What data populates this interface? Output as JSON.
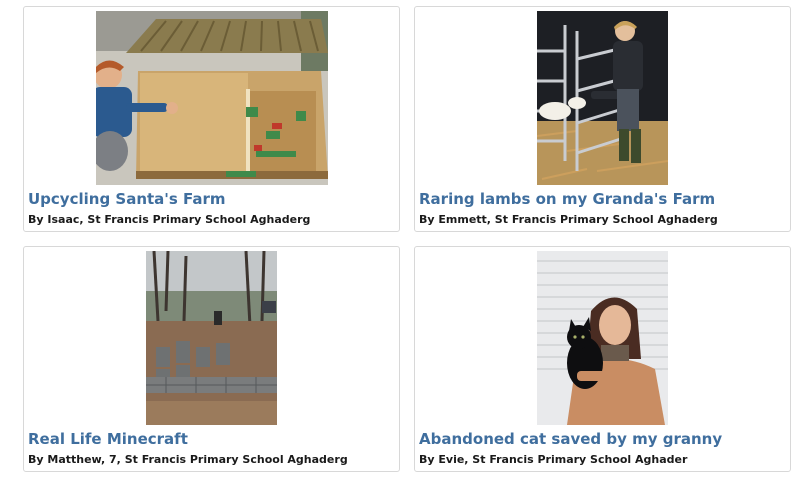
{
  "accent_link_color": "#3f6e9e",
  "cards": [
    {
      "title": "Upcycling Santa's Farm",
      "byline": "By Isaac, St Francis Primary School Aghaderg",
      "image_subject": "boy beside handmade wooden toy farm"
    },
    {
      "title": "Raring lambs on my Granda's Farm",
      "byline": "By Emmett, St Francis Primary School Aghaderg",
      "image_subject": "boy feeding lamb at metal gate in straw pen"
    },
    {
      "title": "Real Life Minecraft",
      "byline": "By Matthew, 7, St Francis Primary School Aghaderg",
      "image_subject": "stone block raised beds in a forest clearing"
    },
    {
      "title": "Abandoned cat saved by my granny",
      "byline": "By Evie, St Francis Primary School Aghader",
      "image_subject": "woman holding a black cat in front of garage door"
    }
  ]
}
